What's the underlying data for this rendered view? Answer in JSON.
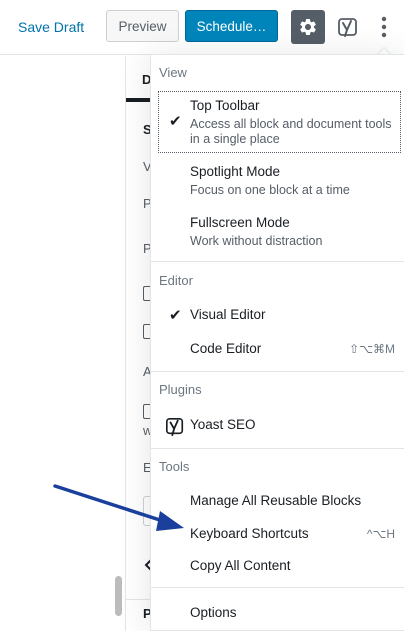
{
  "toolbar": {
    "save_draft": "Save Draft",
    "preview": "Preview",
    "schedule": "Schedule…"
  },
  "sidebar": {
    "tab_letter": "D",
    "letters": [
      "S",
      "V",
      "P",
      "P",
      "A",
      "w",
      "E",
      "P"
    ]
  },
  "menu": {
    "view": {
      "label": "View",
      "items": [
        {
          "label": "Top Toolbar",
          "description": "Access all block and document tools in a single place",
          "checked": true
        },
        {
          "label": "Spotlight Mode",
          "description": "Focus on one block at a time",
          "checked": false
        },
        {
          "label": "Fullscreen Mode",
          "description": "Work without distraction",
          "checked": false
        }
      ]
    },
    "editor": {
      "label": "Editor",
      "items": [
        {
          "label": "Visual Editor",
          "checked": true,
          "shortcut": ""
        },
        {
          "label": "Code Editor",
          "checked": false,
          "shortcut": "⇧⌥⌘M"
        }
      ]
    },
    "plugins": {
      "label": "Plugins",
      "items": [
        {
          "label": "Yoast SEO"
        }
      ]
    },
    "tools": {
      "label": "Tools",
      "items": [
        {
          "label": "Manage All Reusable Blocks",
          "shortcut": ""
        },
        {
          "label": "Keyboard Shortcuts",
          "shortcut": "^⌥H"
        },
        {
          "label": "Copy All Content",
          "shortcut": ""
        }
      ]
    },
    "options": {
      "label": "Options"
    },
    "check_glyph": "✔"
  },
  "colors": {
    "primary": "#0085ba",
    "link": "#0073aa",
    "arrow": "#1a3f9c",
    "gear_bg": "#555d66"
  },
  "icons": {
    "settings": "gear-icon",
    "yoast": "yoast-icon",
    "more": "more-vertical-icon"
  }
}
